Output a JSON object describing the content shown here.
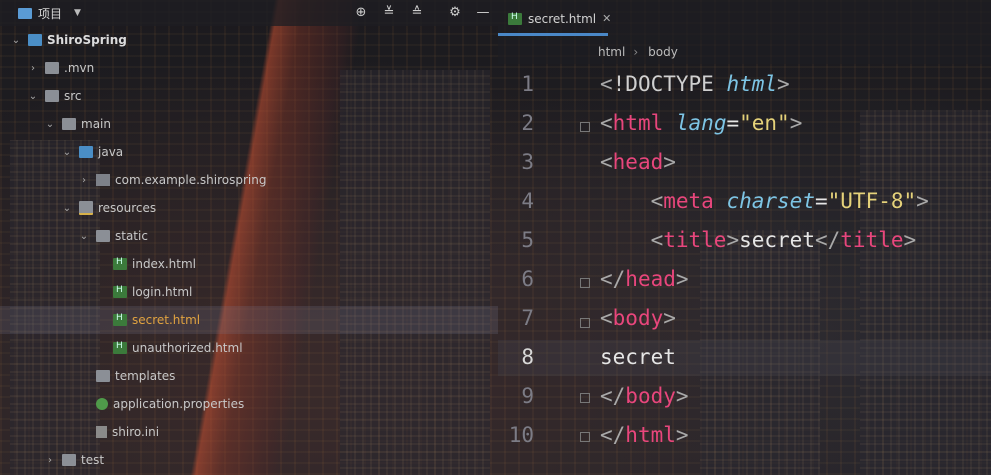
{
  "project_panel": {
    "title": "项目",
    "tree": [
      {
        "label": "ShiroSpring",
        "icon": "module-folder-icon",
        "expanded": true,
        "depth": 0
      },
      {
        "label": ".mvn",
        "icon": "folder-icon",
        "expanded": false,
        "depth": 1
      },
      {
        "label": "src",
        "icon": "folder-icon",
        "expanded": true,
        "depth": 1
      },
      {
        "label": "main",
        "icon": "folder-icon",
        "expanded": true,
        "depth": 2
      },
      {
        "label": "java",
        "icon": "source-folder-icon",
        "expanded": true,
        "depth": 3
      },
      {
        "label": "com.example.shirospring",
        "icon": "package-icon",
        "expanded": false,
        "depth": 4
      },
      {
        "label": "resources",
        "icon": "resources-folder-icon",
        "expanded": true,
        "depth": 3
      },
      {
        "label": "static",
        "icon": "folder-icon",
        "expanded": true,
        "depth": 4
      },
      {
        "label": "index.html",
        "icon": "html-file-icon",
        "depth": 5
      },
      {
        "label": "login.html",
        "icon": "html-file-icon",
        "depth": 5
      },
      {
        "label": "secret.html",
        "icon": "html-file-icon",
        "depth": 5,
        "selected": true
      },
      {
        "label": "unauthorized.html",
        "icon": "html-file-icon",
        "depth": 5
      },
      {
        "label": "templates",
        "icon": "folder-icon",
        "depth": 4
      },
      {
        "label": "application.properties",
        "icon": "properties-file-icon",
        "depth": 4
      },
      {
        "label": "shiro.ini",
        "icon": "ini-file-icon",
        "depth": 4
      },
      {
        "label": "test",
        "icon": "folder-icon",
        "expanded": false,
        "depth": 2
      }
    ]
  },
  "editor": {
    "tab_label": "secret.html",
    "breadcrumb": [
      "html",
      "body"
    ],
    "current_line": 8,
    "line_numbers": [
      "1",
      "2",
      "3",
      "4",
      "5",
      "6",
      "7",
      "8",
      "9",
      "10"
    ]
  },
  "colors": {
    "accent": "#4a88c7",
    "selected_text": "#e0a340",
    "tag": "#e8467c",
    "attr": "#7dc4e4",
    "string": "#e5d27a"
  }
}
